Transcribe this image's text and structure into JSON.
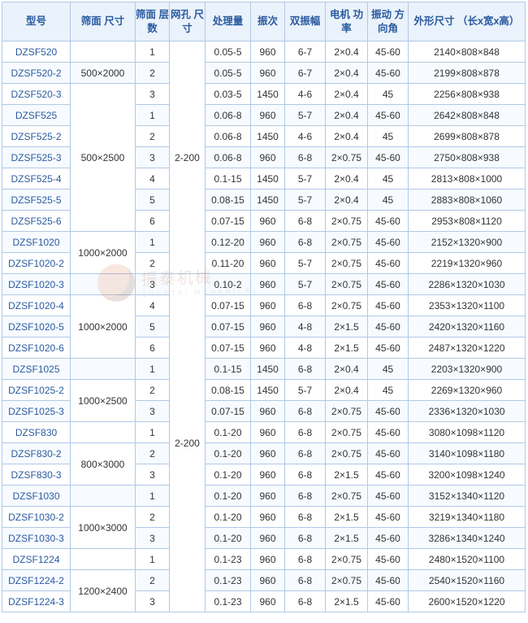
{
  "headers": {
    "model": "型号",
    "screen_size": "筛面\n尺寸",
    "layers": "筛面\n层数",
    "mesh": "网孔\n尺寸",
    "capacity": "处理量",
    "freq": "振次",
    "amplitude": "双振幅",
    "motor": "电机\n功率",
    "angle": "振动\n方向角",
    "dimensions": "外形尺寸\n（长x宽x高）"
  },
  "mesh_groups": [
    {
      "value": "2-200",
      "span": 11
    },
    {
      "value": "2-200",
      "span": 16
    }
  ],
  "screen_groups": [
    {
      "value": "",
      "span": 1
    },
    {
      "value": "500×2000",
      "span": 1
    },
    {
      "value": "500×2500",
      "span": 7
    },
    {
      "value": "1000×2000",
      "span": 2
    },
    {
      "value": "",
      "span": 1
    },
    {
      "value": "1000×2000",
      "span": 3
    },
    {
      "value": "",
      "span": 1
    },
    {
      "value": "1000×2500",
      "span": 2
    },
    {
      "value": "",
      "span": 1
    },
    {
      "value": "800×3000",
      "span": 2
    },
    {
      "value": "",
      "span": 1
    },
    {
      "value": "1000×3000",
      "span": 2
    },
    {
      "value": "",
      "span": 1
    },
    {
      "value": "1200×2400",
      "span": 2
    }
  ],
  "rows": [
    {
      "model": "DZSF520",
      "layers": "1",
      "capacity": "0.05-5",
      "freq": "960",
      "amp": "6-7",
      "motor": "2×0.4",
      "angle": "45-60",
      "dim": "2140×808×848"
    },
    {
      "model": "DZSF520-2",
      "layers": "2",
      "capacity": "0.05-5",
      "freq": "960",
      "amp": "6-7",
      "motor": "2×0.4",
      "angle": "45-60",
      "dim": "2199×808×878"
    },
    {
      "model": "DZSF520-3",
      "layers": "3",
      "capacity": "0.03-5",
      "freq": "1450",
      "amp": "4-6",
      "motor": "2×0.4",
      "angle": "45",
      "dim": "2256×808×938"
    },
    {
      "model": "DZSF525",
      "layers": "1",
      "capacity": "0.06-8",
      "freq": "960",
      "amp": "5-7",
      "motor": "2×0.4",
      "angle": "45-60",
      "dim": "2642×808×848"
    },
    {
      "model": "DZSF525-2",
      "layers": "2",
      "capacity": "0.06-8",
      "freq": "1450",
      "amp": "4-6",
      "motor": "2×0.4",
      "angle": "45",
      "dim": "2699×808×878"
    },
    {
      "model": "DZSF525-3",
      "layers": "3",
      "capacity": "0.06-8",
      "freq": "960",
      "amp": "6-8",
      "motor": "2×0.75",
      "angle": "45-60",
      "dim": "2750×808×938"
    },
    {
      "model": "DZSF525-4",
      "layers": "4",
      "capacity": "0.1-15",
      "freq": "1450",
      "amp": "5-7",
      "motor": "2×0.4",
      "angle": "45",
      "dim": "2813×808×1000"
    },
    {
      "model": "DZSF525-5",
      "layers": "5",
      "capacity": "0.08-15",
      "freq": "1450",
      "amp": "5-7",
      "motor": "2×0.4",
      "angle": "45",
      "dim": "2883×808×1060"
    },
    {
      "model": "DZSF525-6",
      "layers": "6",
      "capacity": "0.07-15",
      "freq": "960",
      "amp": "6-8",
      "motor": "2×0.75",
      "angle": "45-60",
      "dim": "2953×808×1120"
    },
    {
      "model": "DZSF1020",
      "layers": "1",
      "capacity": "0.12-20",
      "freq": "960",
      "amp": "6-8",
      "motor": "2×0.75",
      "angle": "45-60",
      "dim": "2152×1320×900"
    },
    {
      "model": "DZSF1020-2",
      "layers": "2",
      "capacity": "0.11-20",
      "freq": "960",
      "amp": "5-7",
      "motor": "2×0.75",
      "angle": "45-60",
      "dim": "2219×1320×960"
    },
    {
      "model": "DZSF1020-3",
      "layers": "3",
      "capacity": "0.10-2",
      "freq": "960",
      "amp": "5-7",
      "motor": "2×0.75",
      "angle": "45-60",
      "dim": "2286×1320×1030"
    },
    {
      "model": "DZSF1020-4",
      "layers": "4",
      "capacity": "0.07-15",
      "freq": "960",
      "amp": "6-8",
      "motor": "2×0.75",
      "angle": "45-60",
      "dim": "2353×1320×1100"
    },
    {
      "model": "DZSF1020-5",
      "layers": "5",
      "capacity": "0.07-15",
      "freq": "960",
      "amp": "4-8",
      "motor": "2×1.5",
      "angle": "45-60",
      "dim": "2420×1320×1160"
    },
    {
      "model": "DZSF1020-6",
      "layers": "6",
      "capacity": "0.07-15",
      "freq": "960",
      "amp": "4-8",
      "motor": "2×1.5",
      "angle": "45-60",
      "dim": "2487×1320×1220"
    },
    {
      "model": "DZSF1025",
      "layers": "1",
      "capacity": "0.1-15",
      "freq": "1450",
      "amp": "6-8",
      "motor": "2×0.4",
      "angle": "45",
      "dim": "2203×1320×900"
    },
    {
      "model": "DZSF1025-2",
      "layers": "2",
      "capacity": "0.08-15",
      "freq": "1450",
      "amp": "5-7",
      "motor": "2×0.4",
      "angle": "45",
      "dim": "2269×1320×960"
    },
    {
      "model": "DZSF1025-3",
      "layers": "3",
      "capacity": "0.07-15",
      "freq": "960",
      "amp": "6-8",
      "motor": "2×0.75",
      "angle": "45-60",
      "dim": "2336×1320×1030"
    },
    {
      "model": "DZSF830",
      "layers": "1",
      "capacity": "0.1-20",
      "freq": "960",
      "amp": "6-8",
      "motor": "2×0.75",
      "angle": "45-60",
      "dim": "3080×1098×1120"
    },
    {
      "model": "DZSF830-2",
      "layers": "2",
      "capacity": "0.1-20",
      "freq": "960",
      "amp": "6-8",
      "motor": "2×0.75",
      "angle": "45-60",
      "dim": "3140×1098×1180"
    },
    {
      "model": "DZSF830-3",
      "layers": "3",
      "capacity": "0.1-20",
      "freq": "960",
      "amp": "6-8",
      "motor": "2×1.5",
      "angle": "45-60",
      "dim": "3200×1098×1240"
    },
    {
      "model": "DZSF1030",
      "layers": "1",
      "capacity": "0.1-20",
      "freq": "960",
      "amp": "6-8",
      "motor": "2×0.75",
      "angle": "45-60",
      "dim": "3152×1340×1120"
    },
    {
      "model": "DZSF1030-2",
      "layers": "2",
      "capacity": "0.1-20",
      "freq": "960",
      "amp": "6-8",
      "motor": "2×1.5",
      "angle": "45-60",
      "dim": "3219×1340×1180"
    },
    {
      "model": "DZSF1030-3",
      "layers": "3",
      "capacity": "0.1-20",
      "freq": "960",
      "amp": "6-8",
      "motor": "2×1.5",
      "angle": "45-60",
      "dim": "3286×1340×1240"
    },
    {
      "model": "DZSF1224",
      "layers": "1",
      "capacity": "0.1-23",
      "freq": "960",
      "amp": "6-8",
      "motor": "2×0.75",
      "angle": "45-60",
      "dim": "2480×1520×1100"
    },
    {
      "model": "DZSF1224-2",
      "layers": "2",
      "capacity": "0.1-23",
      "freq": "960",
      "amp": "6-8",
      "motor": "2×0.75",
      "angle": "45-60",
      "dim": "2540×1520×1160"
    },
    {
      "model": "DZSF1224-3",
      "layers": "3",
      "capacity": "0.1-23",
      "freq": "960",
      "amp": "6-8",
      "motor": "2×1.5",
      "angle": "45-60",
      "dim": "2600×1520×1220"
    }
  ],
  "watermark": {
    "main": "振泰机械",
    "sub": "ZHENTAI MCHANICAL"
  }
}
